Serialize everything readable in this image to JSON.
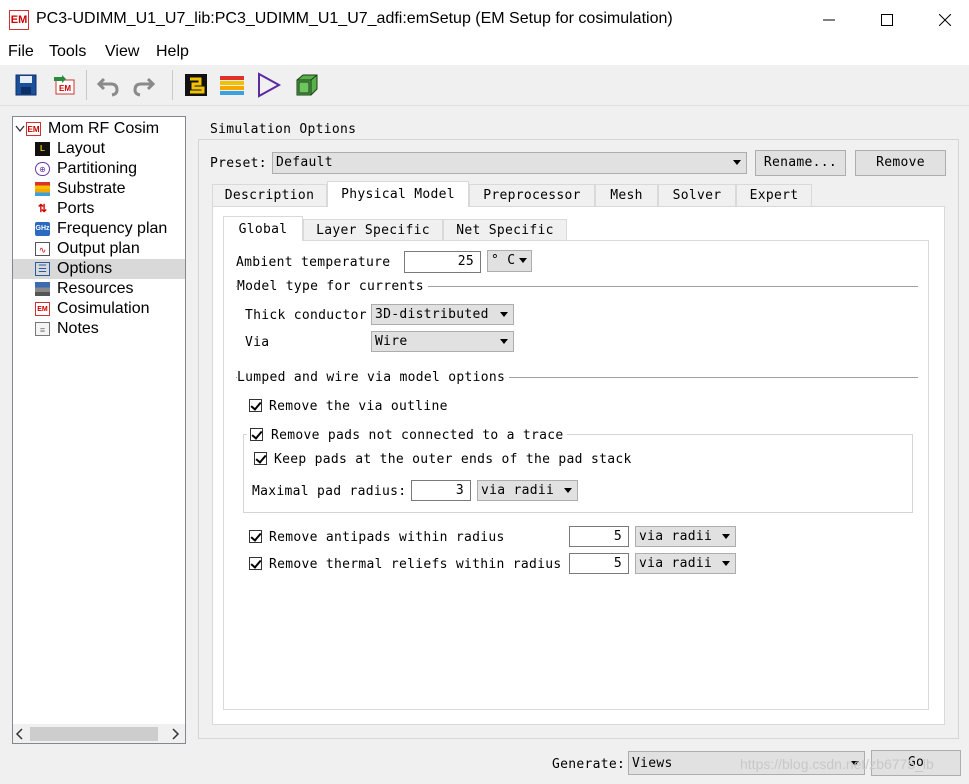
{
  "window": {
    "title": "PC3-UDIMM_U1_U7_lib:PC3_UDIMM_U1_U7_adfi:emSetup (EM Setup for cosimulation)",
    "icon_text": "EM"
  },
  "menu": [
    "File",
    "Tools",
    "View",
    "Help"
  ],
  "toolbar": {
    "icons": [
      "save-icon",
      "em-export-icon",
      "undo-icon",
      "redo-icon",
      "layout-icon",
      "substrate-icon",
      "simulate-icon",
      "3d-view-icon"
    ]
  },
  "tree": {
    "root": "Mom RF Cosim",
    "items": [
      "Layout",
      "Partitioning",
      "Substrate",
      "Ports",
      "Frequency plan",
      "Output plan",
      "Options",
      "Resources",
      "Cosimulation",
      "Notes"
    ],
    "selected": "Options"
  },
  "sim_options": {
    "title": "Simulation Options",
    "preset_label": "Preset:",
    "preset_value": "Default",
    "rename_button": "Rename...",
    "remove_button": "Remove"
  },
  "tabs": [
    "Description",
    "Physical Model",
    "Preprocessor",
    "Mesh",
    "Solver",
    "Expert"
  ],
  "active_tab": "Physical Model",
  "subtabs": [
    "Global",
    "Layer Specific",
    "Net Specific"
  ],
  "active_subtab": "Global",
  "global": {
    "ambient_label": "Ambient temperature",
    "ambient_value": "25",
    "ambient_unit": "° C",
    "model_type_header": "Model type for currents",
    "thick_label": "Thick conductor",
    "thick_value": "3D-distributed",
    "via_label": "Via",
    "via_value": "Wire",
    "lumped_header": "Lumped and wire via model options",
    "remove_outline": "Remove the via outline",
    "remove_pads": "Remove pads not connected to a trace",
    "keep_pads": "Keep pads at the outer ends of the pad stack",
    "max_pad_label": "Maximal pad radius:",
    "max_pad_value": "3",
    "max_pad_unit": "via radii",
    "antipads_label": "Remove antipads within radius",
    "antipads_value": "5",
    "antipads_unit": "via radii",
    "thermal_label": "Remove thermal reliefs within radius",
    "thermal_value": "5",
    "thermal_unit": "via radii"
  },
  "footer": {
    "generate_label": "Generate:",
    "generate_value": "Views",
    "go_button": "Go"
  },
  "watermark": "https://blog.csdn.net/zb6775_lb"
}
